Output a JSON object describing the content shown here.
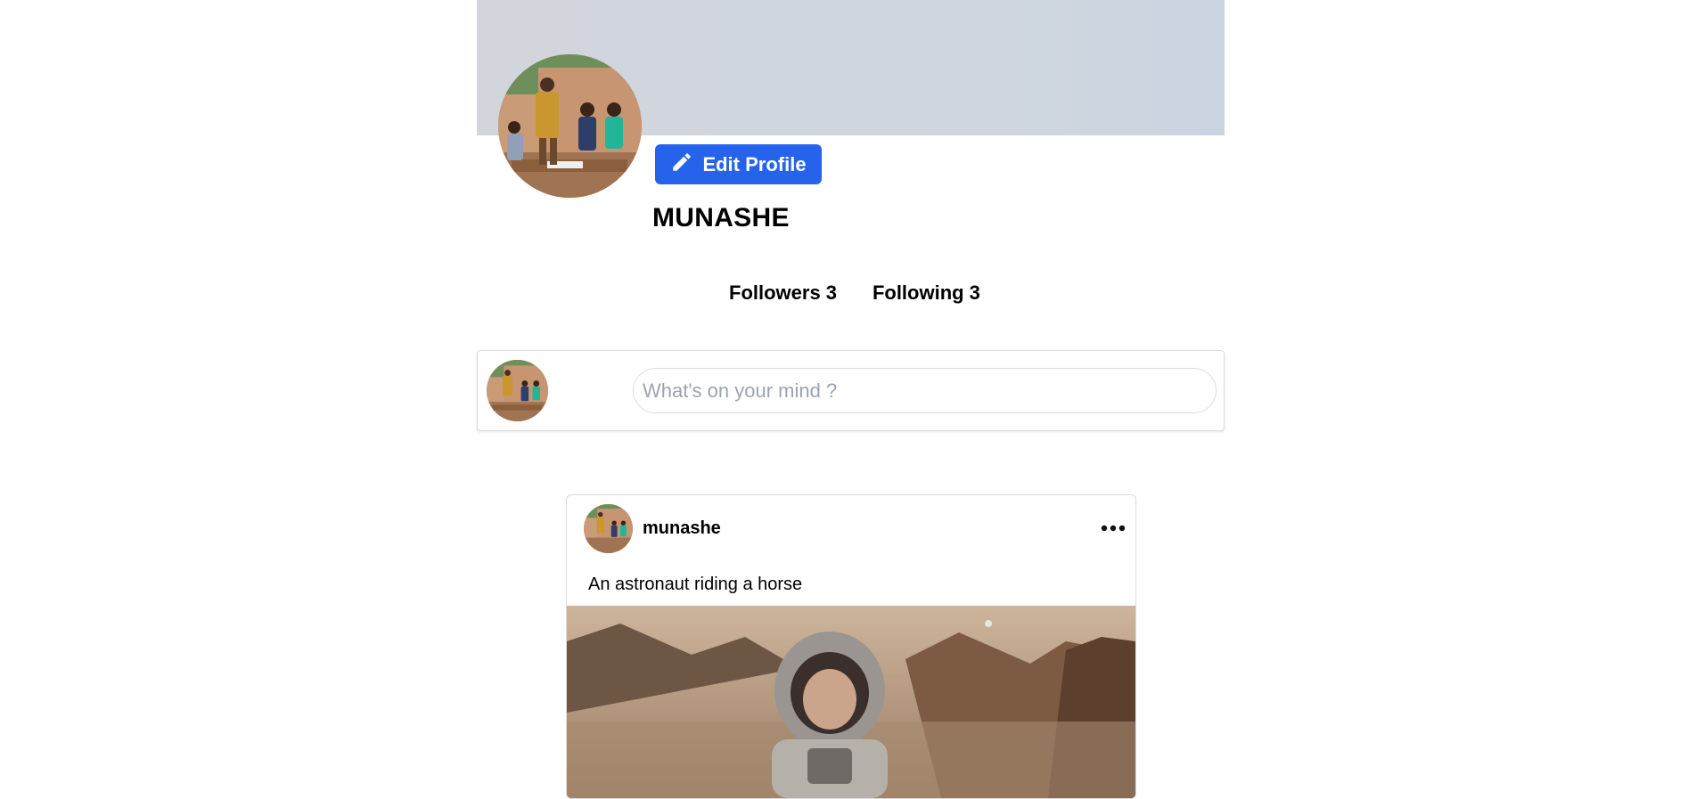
{
  "profile": {
    "username": "MUNASHE",
    "edit_button_label": "Edit Profile",
    "stats": {
      "followers_label": "Followers",
      "followers_count": "3",
      "following_label": "Following",
      "following_count": "3"
    }
  },
  "composer": {
    "placeholder": "What's on your mind ?"
  },
  "post": {
    "author": "munashe",
    "caption": "An astronaut riding a horse"
  },
  "icons": {
    "edit": "pencil-icon",
    "menu": "more-horizontal-icon"
  },
  "colors": {
    "primary_button": "#2563eb",
    "cover": "#d0d6df"
  }
}
